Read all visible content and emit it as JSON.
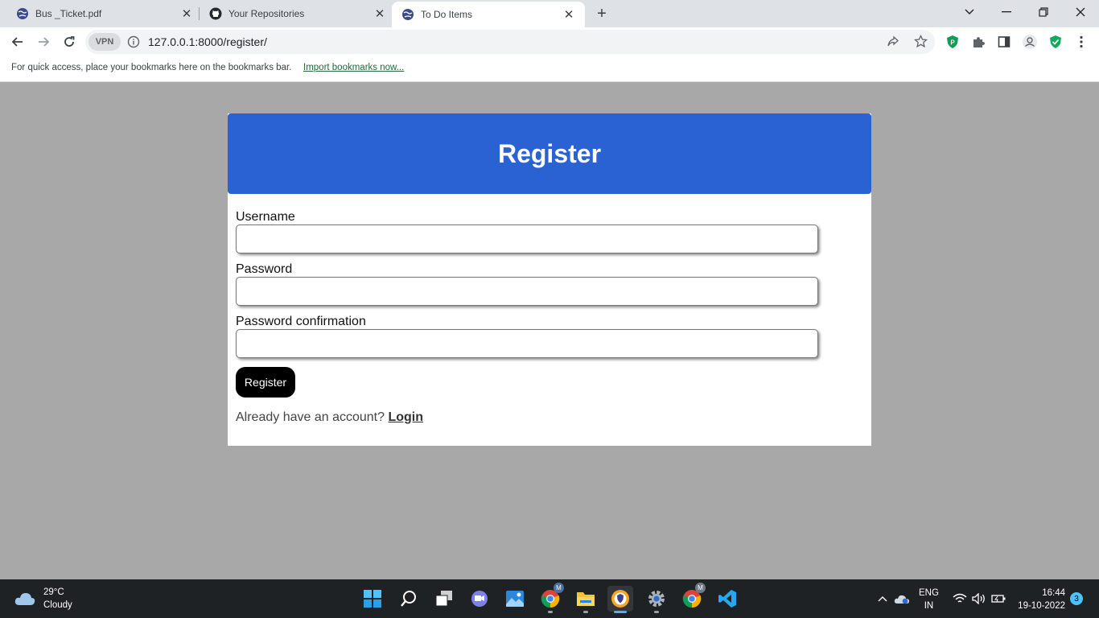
{
  "browser": {
    "tabs": [
      {
        "title": "Bus _Ticket.pdf",
        "icon": "globe-icon"
      },
      {
        "title": "Your Repositories",
        "icon": "github-icon"
      },
      {
        "title": "To Do Items",
        "icon": "globe-icon",
        "active": true
      }
    ],
    "vpn_label": "VPN",
    "url": "127.0.0.1:8000/register/",
    "bookmarks_prompt": "For quick access, place your bookmarks here on the bookmarks bar.",
    "bookmarks_link": "Import bookmarks now...",
    "accent_color": "#1a73e8"
  },
  "page": {
    "header_title": "Register",
    "header_color": "#2a62d4",
    "fields": [
      {
        "label": "Username",
        "value": ""
      },
      {
        "label": "Password",
        "value": ""
      },
      {
        "label": "Password confirmation",
        "value": ""
      }
    ],
    "submit_label": "Register",
    "login_prompt": "Already have an account?",
    "login_link": "Login"
  },
  "taskbar": {
    "weather_temp": "29°C",
    "weather_desc": "Cloudy",
    "lang_line1": "ENG",
    "lang_line2": "IN",
    "time": "16:44",
    "date": "19-10-2022",
    "notification_count": "3",
    "chrome_badge": "M"
  }
}
